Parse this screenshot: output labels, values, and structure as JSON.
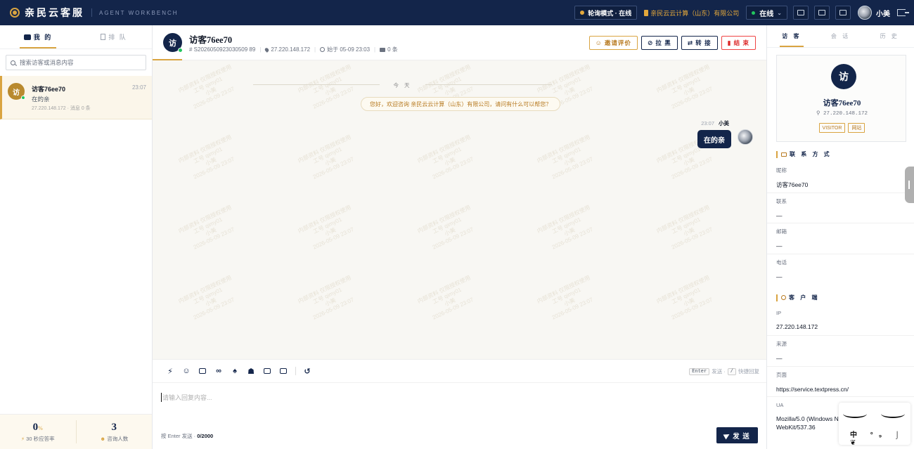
{
  "topbar": {
    "brand": "亲民云客服",
    "subtitle": "AGENT WORKBENCH",
    "poll_mode": "轮询模式 · 在线",
    "company": "亲民云云计算（山东）有限公司",
    "status": "在线",
    "user_name": "小美"
  },
  "left": {
    "tab_mine": "我 的",
    "tab_queue": "排 队",
    "search_placeholder": "搜索访客或消息内容",
    "session": {
      "avatar": "访",
      "name": "访客76ee70",
      "time": "23:07",
      "last_msg": "在的亲",
      "meta": "27.220.148.172 · 消息 0 条"
    },
    "stats": {
      "rate_value": "0",
      "rate_unit": "%",
      "rate_label": "30 秒应答率",
      "count_value": "3",
      "count_label": "咨询人数"
    }
  },
  "chat": {
    "avatar": "访",
    "title": "访客76ee70",
    "session_id": "# S2026050923030509 89",
    "ip": "27.220.148.172",
    "started": "始于 05-09 23:03",
    "msg_count": "0 条",
    "actions": {
      "invite": "邀请评价",
      "block": "拉 黑",
      "transfer": "转 接",
      "end": "结 束"
    },
    "today": "今 天",
    "welcome": "您好，欢迎咨询 亲民云云计算（山东）有限公司，请问有什么可以帮您？",
    "message": {
      "time": "23:07",
      "sender": "小美",
      "text": "在的亲"
    },
    "watermark": [
      "内部资料 仅限授权使用",
      "工号 qimy01",
      "小美",
      "2026-05-09 23:07"
    ],
    "hint_enter": "Enter",
    "hint_send": "发送 ·",
    "hint_slash": "/",
    "hint_quick": "快捷回复",
    "input_placeholder": "请输入回复内容...",
    "footer_info": "按 Enter 发送 ·",
    "char_count": "0/2000",
    "send": "发 送"
  },
  "right": {
    "tab_visitor": "访 客",
    "tab_session": "会 话",
    "tab_history": "历 史",
    "avatar": "访",
    "name": "访客76ee70",
    "ip": "27.220.148.172",
    "tag1": "VISITOR",
    "tag2": "网站",
    "contact_title": "联 系 方 式",
    "client_title": "客 户 端",
    "fields": [
      {
        "k": "昵称",
        "v": "访客76ee70"
      },
      {
        "k": "联系",
        "v": "—"
      },
      {
        "k": "邮箱",
        "v": "—"
      },
      {
        "k": "电话",
        "v": "—"
      },
      {
        "k": "IP",
        "v": "27.220.148.172"
      },
      {
        "k": "来源",
        "v": "—"
      },
      {
        "k": "页面",
        "v": "https://service.textpress.cn/"
      },
      {
        "k": "UA",
        "v": "Mozilla/5.0 (Windows N"
      },
      {
        "k": "",
        "v": "WebKit/537.36"
      }
    ]
  },
  "mascot_text": "中 °₉ ⌡ ❦"
}
